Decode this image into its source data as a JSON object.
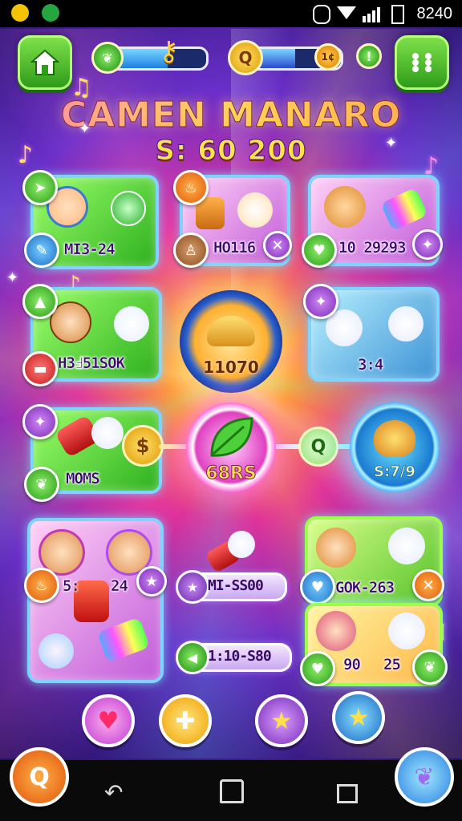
{
  "status_bar": {
    "time": "8240"
  },
  "header": {
    "home_icon": "home-icon",
    "menu_icon": "grid-menu-icon",
    "energy_progress": 0.62,
    "coin_progress": 0.55,
    "coin_badge_text": "1¢",
    "alert_text": "!"
  },
  "title": {
    "line1": "CAMEN MANARO",
    "line2": "S: 60 200"
  },
  "cards": {
    "top_left": {
      "label": "MI3-24"
    },
    "top_mid": {
      "label": "HO116"
    },
    "top_right": {
      "label": "10 29293"
    },
    "mid_left": {
      "label": "H3Ⅎ51SOK"
    },
    "mid_right": {
      "label": "3:4"
    },
    "row3_left": {
      "label": "MOMS"
    },
    "bottom_left": {
      "label_a": "5:",
      "label_b": "24"
    },
    "bottom_right_top": {
      "label": "GOK-263"
    },
    "bottom_right_bottom": {
      "label_a": "90",
      "label_b": "25"
    }
  },
  "hubs": {
    "croissant": {
      "value": "11070"
    },
    "leaf": {
      "value": "68RS"
    },
    "honey": {
      "value": "S:7/9"
    }
  },
  "pills": {
    "pill1": {
      "label": "MI-SS00"
    },
    "pill2": {
      "label": "1:10-S80"
    }
  },
  "bottom_buttons": [
    "heart-icon",
    "puzzle-icon",
    "star-icon",
    "star-icon"
  ],
  "colors": {
    "accent_green": "#2f9c1a",
    "accent_blue": "#1d7fe0",
    "accent_purple": "#7a2ab8"
  }
}
